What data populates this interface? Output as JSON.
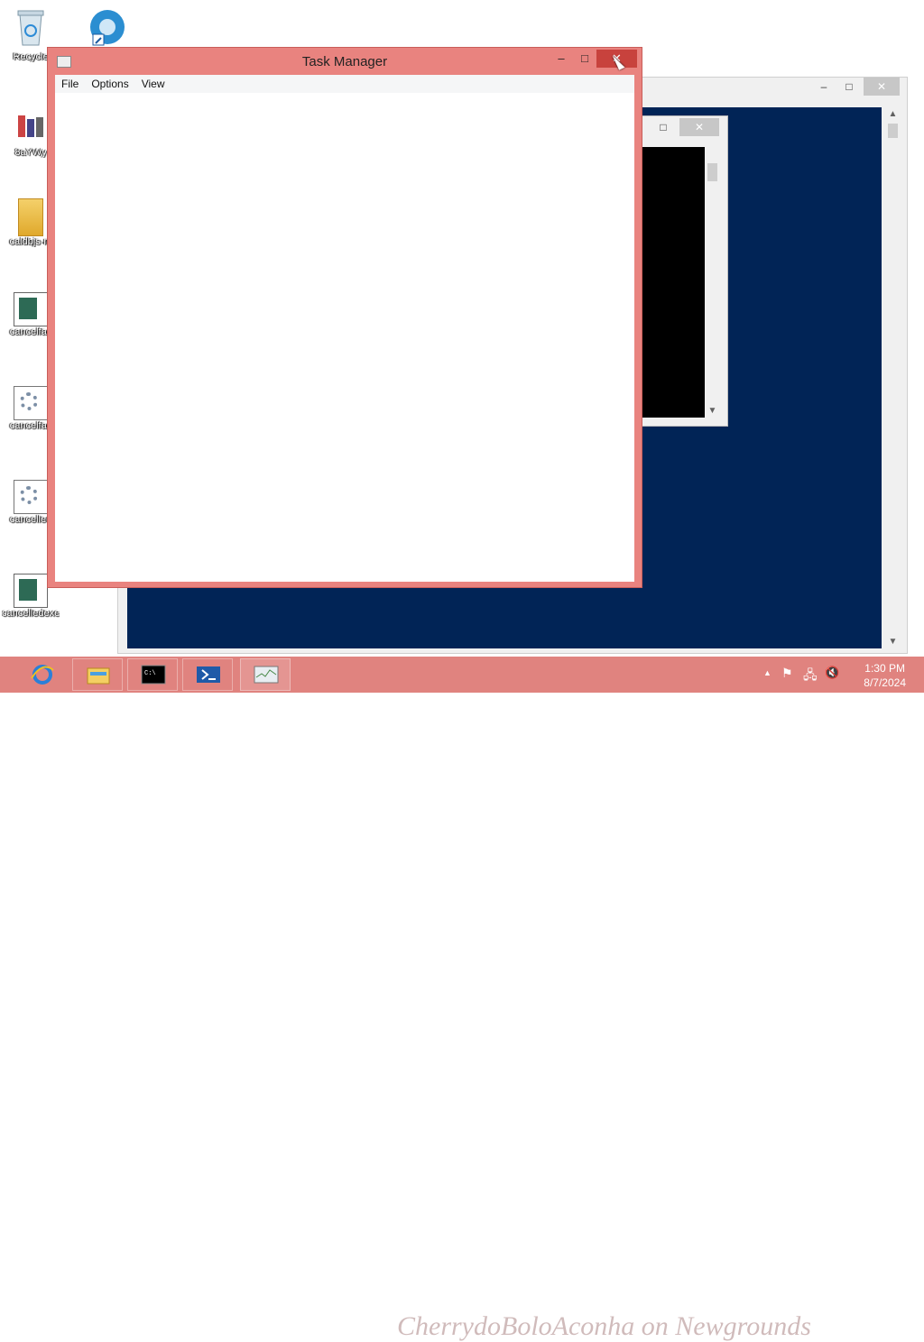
{
  "desktop": {
    "icons": [
      {
        "label": "Recycle",
        "icon": "recycle-bin-icon"
      },
      {
        "label": "",
        "icon": "browser-shortcut-icon"
      },
      {
        "label": "8aYWy",
        "icon": "app-icon"
      },
      {
        "label": "caldbjs-m",
        "icon": "folder-zip-icon"
      },
      {
        "label": "cancelfac",
        "icon": "document-icon"
      },
      {
        "label": "cancelfac",
        "icon": "settings-file-icon"
      },
      {
        "label": "cancelled",
        "icon": "settings-file-icon"
      },
      {
        "label": "cancelledexe",
        "icon": "document-icon"
      }
    ]
  },
  "task_manager": {
    "title": "Task Manager",
    "menu": [
      "File",
      "Options",
      "View"
    ],
    "min_glyph": "–",
    "max_glyph": "□",
    "close_glyph": "✕"
  },
  "background_window": {
    "min_glyph": "–",
    "max_glyph": "□",
    "close_glyph": "✕"
  },
  "cmd_window": {
    "max_glyph": "□",
    "close_glyph": "✕"
  },
  "taskbar": {
    "items": [
      "internet-explorer-icon",
      "file-explorer-icon",
      "command-prompt-icon",
      "powershell-icon",
      "task-manager-icon"
    ],
    "clock_time": "1:30 PM",
    "clock_date": "8/7/2024",
    "watermark": "CherrydoBoloAconha on Newgrounds"
  },
  "colors": {
    "accent": "#e9837f",
    "powershell_bg": "#012456"
  }
}
